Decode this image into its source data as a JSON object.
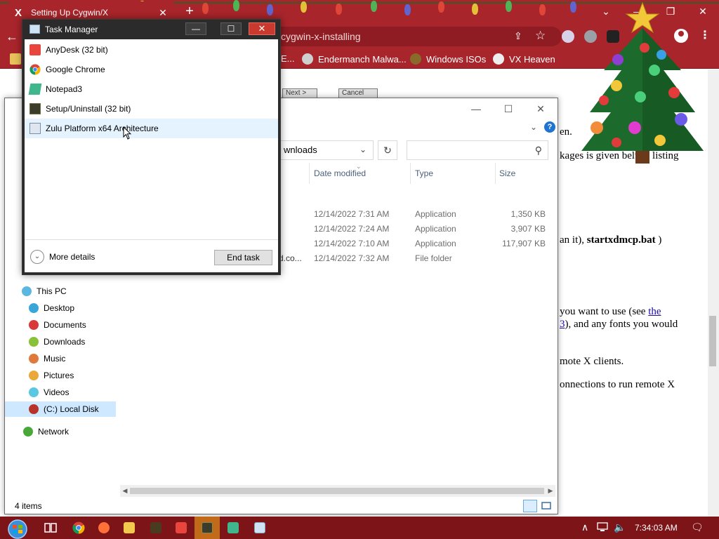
{
  "browser": {
    "tab_title": "Setting Up Cygwin/X",
    "tab_close": "✕",
    "tab_favicon": "x-logo-icon",
    "new_tab": "+",
    "window_controls": [
      "⌄",
      "—",
      "❐",
      "✕"
    ],
    "omnibox_text": "cygwin-x-installing",
    "bookmarks": [
      {
        "label": "E...",
        "icon": "folder-icon"
      },
      {
        "label": "Endermanch Malwa...",
        "icon": "endermanch-icon"
      },
      {
        "label": "Windows ISOs",
        "icon": "windows-isos-icon"
      },
      {
        "label": "VX Heaven",
        "icon": "vx-heaven-icon"
      }
    ],
    "accent": "#a8252b"
  },
  "webpage": {
    "lines": [
      "en.",
      "kages is given bel",
      "w a listing",
      "an it), ",
      "startxdmcp.bat",
      " )",
      "you want to use (see ",
      "the",
      "3",
      "), and any fonts you would",
      "mote X clients.",
      "onnections to run remote X"
    ],
    "installer_buttons": [
      "Next >",
      "Cancel"
    ]
  },
  "explorer": {
    "ribbon_chevron": "⌄",
    "help": "?",
    "address_text": "wnloads",
    "refresh": "↻",
    "columns": [
      "Date modified",
      "Type",
      "Size"
    ],
    "files": [
      {
        "name": "",
        "date": "12/14/2022 7:31 AM",
        "type": "Application",
        "size": "1,350 KB"
      },
      {
        "name": "",
        "date": "12/14/2022 7:24 AM",
        "type": "Application",
        "size": "3,907 KB"
      },
      {
        "name": "",
        "date": "12/14/2022 7:10 AM",
        "type": "Application",
        "size": "117,907 KB"
      },
      {
        "name": "d.co...",
        "date": "12/14/2022 7:32 AM",
        "type": "File folder",
        "size": ""
      }
    ],
    "nav": [
      {
        "label": "This PC",
        "icon": "this-pc-icon"
      },
      {
        "label": "Desktop",
        "icon": "desktop-icon"
      },
      {
        "label": "Documents",
        "icon": "documents-icon"
      },
      {
        "label": "Downloads",
        "icon": "downloads-icon"
      },
      {
        "label": "Music",
        "icon": "music-icon"
      },
      {
        "label": "Pictures",
        "icon": "pictures-icon"
      },
      {
        "label": "Videos",
        "icon": "videos-icon"
      },
      {
        "label": "(C:) Local Disk",
        "icon": "local-disk-icon"
      },
      {
        "label": "Network",
        "icon": "network-icon"
      }
    ],
    "status_items": "4 items"
  },
  "taskmgr": {
    "title": "Task Manager",
    "apps": [
      {
        "label": "AnyDesk (32 bit)",
        "icon": "anydesk-icon",
        "color": "#e8453c"
      },
      {
        "label": "Google Chrome",
        "icon": "chrome-icon",
        "color": "#4285f4"
      },
      {
        "label": "Notepad3",
        "icon": "notepad3-icon",
        "color": "#3fb68b"
      },
      {
        "label": "Setup/Uninstall (32 bit)",
        "icon": "setup-icon",
        "color": "#3c3c2a"
      },
      {
        "label": "Zulu Platform x64 Architecture",
        "icon": "zulu-icon",
        "color": "#7a8ea8"
      }
    ],
    "more_details": "More details",
    "end_task": "End task",
    "close_glyph": "✕",
    "min_glyph": "—",
    "max_glyph": "☐"
  },
  "taskbar": {
    "time": "7:34:03 AM",
    "tray_chevron": "∧",
    "notification_glyph": "🗨",
    "speaker_glyph": "🔈",
    "background": "#7d1418"
  }
}
